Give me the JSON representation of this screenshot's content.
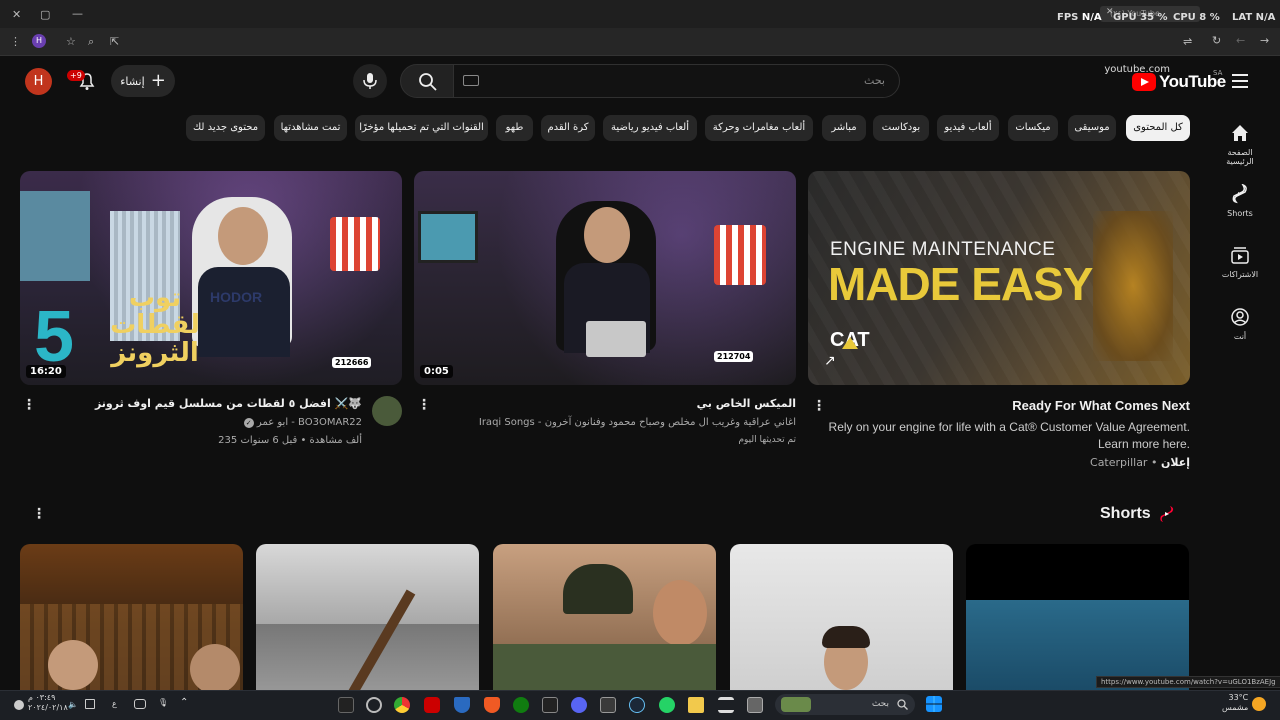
{
  "browser": {
    "tab_title": "(٢٤) YouTube",
    "url": "youtube.com",
    "overlay": {
      "fps_label": "FPS",
      "fps_value": "N/A",
      "gpu_label": "GPU",
      "gpu_value": "35 %",
      "cpu_label": "CPU",
      "cpu_value": "8 %",
      "lat_label": "LAT",
      "lat_value": "N/A"
    },
    "profile_initial": "H"
  },
  "header": {
    "logo_text": "YouTube",
    "region": "SA",
    "search_placeholder": "بحث",
    "create_label": "إنشاء",
    "notifications_badge": "+9",
    "avatar_initial": "H"
  },
  "chips": [
    {
      "label": "كل المحتوى",
      "active": true
    },
    {
      "label": "موسيقى"
    },
    {
      "label": "ميكسات"
    },
    {
      "label": "ألعاب فيديو"
    },
    {
      "label": "بودكاست"
    },
    {
      "label": "مباشر"
    },
    {
      "label": "ألعاب مغامرات وحركة"
    },
    {
      "label": "ألعاب فيديو رياضية"
    },
    {
      "label": "كرة القدم"
    },
    {
      "label": "طهو"
    },
    {
      "label": "القنوات التي تم تحميلها مؤخرًا"
    },
    {
      "label": "تمت مشاهدتها"
    },
    {
      "label": "محتوى جديد لك"
    }
  ],
  "sidebar": [
    {
      "label": "الصفحة الرئيسية",
      "icon": "home-icon"
    },
    {
      "label": "Shorts",
      "icon": "shorts-icon"
    },
    {
      "label": "الاشتراكات",
      "icon": "subscriptions-icon"
    },
    {
      "label": "أنت",
      "icon": "you-icon"
    }
  ],
  "videos": [
    {
      "title": "Ready For What Comes Next",
      "description_line1": "Rely on your engine for life with a Cat® Customer Value Agreement.",
      "description_line2": "Learn more here.",
      "ad_label": "إعلان",
      "channel": "Caterpillar",
      "thumb_text_line1": "ENGINE MAINTENANCE",
      "thumb_text_line2": "MADE EASY",
      "thumb_brand": "CAT"
    },
    {
      "title": "الميكس الخاص بي",
      "channel": "Iraqi Songs - اغاني عراقية وغريب ال مخلص وصباح محمود وفنانون آخرون",
      "meta": "تم تحديثها اليوم",
      "duration": "0:05",
      "thumb_counter": "212704"
    },
    {
      "title": "افضل ٥ لقطات من مسلسل قيم اوف ثرونز ⚔️🐺",
      "channel": "ابو عمر - BO3OMAR22",
      "meta": "235 ألف مشاهدة • قبل 6 سنوات",
      "duration": "16:20",
      "thumb_counter": "212666",
      "thumb_text": "توب لقطات الثرونز",
      "thumb_number": "5",
      "thumb_shirt": "HODOR"
    }
  ],
  "shorts": {
    "heading": "Shorts"
  },
  "status_url": "https://www.youtube.com/watch?v=uGLO1BzAEJg",
  "taskbar": {
    "search_placeholder": "بحث",
    "time": "٠٣:٤٩ م",
    "date": "٢٠٢٤/٠٢/١٨",
    "lang": "ع",
    "weather_temp": "33°C",
    "weather_desc": "مشمس"
  }
}
